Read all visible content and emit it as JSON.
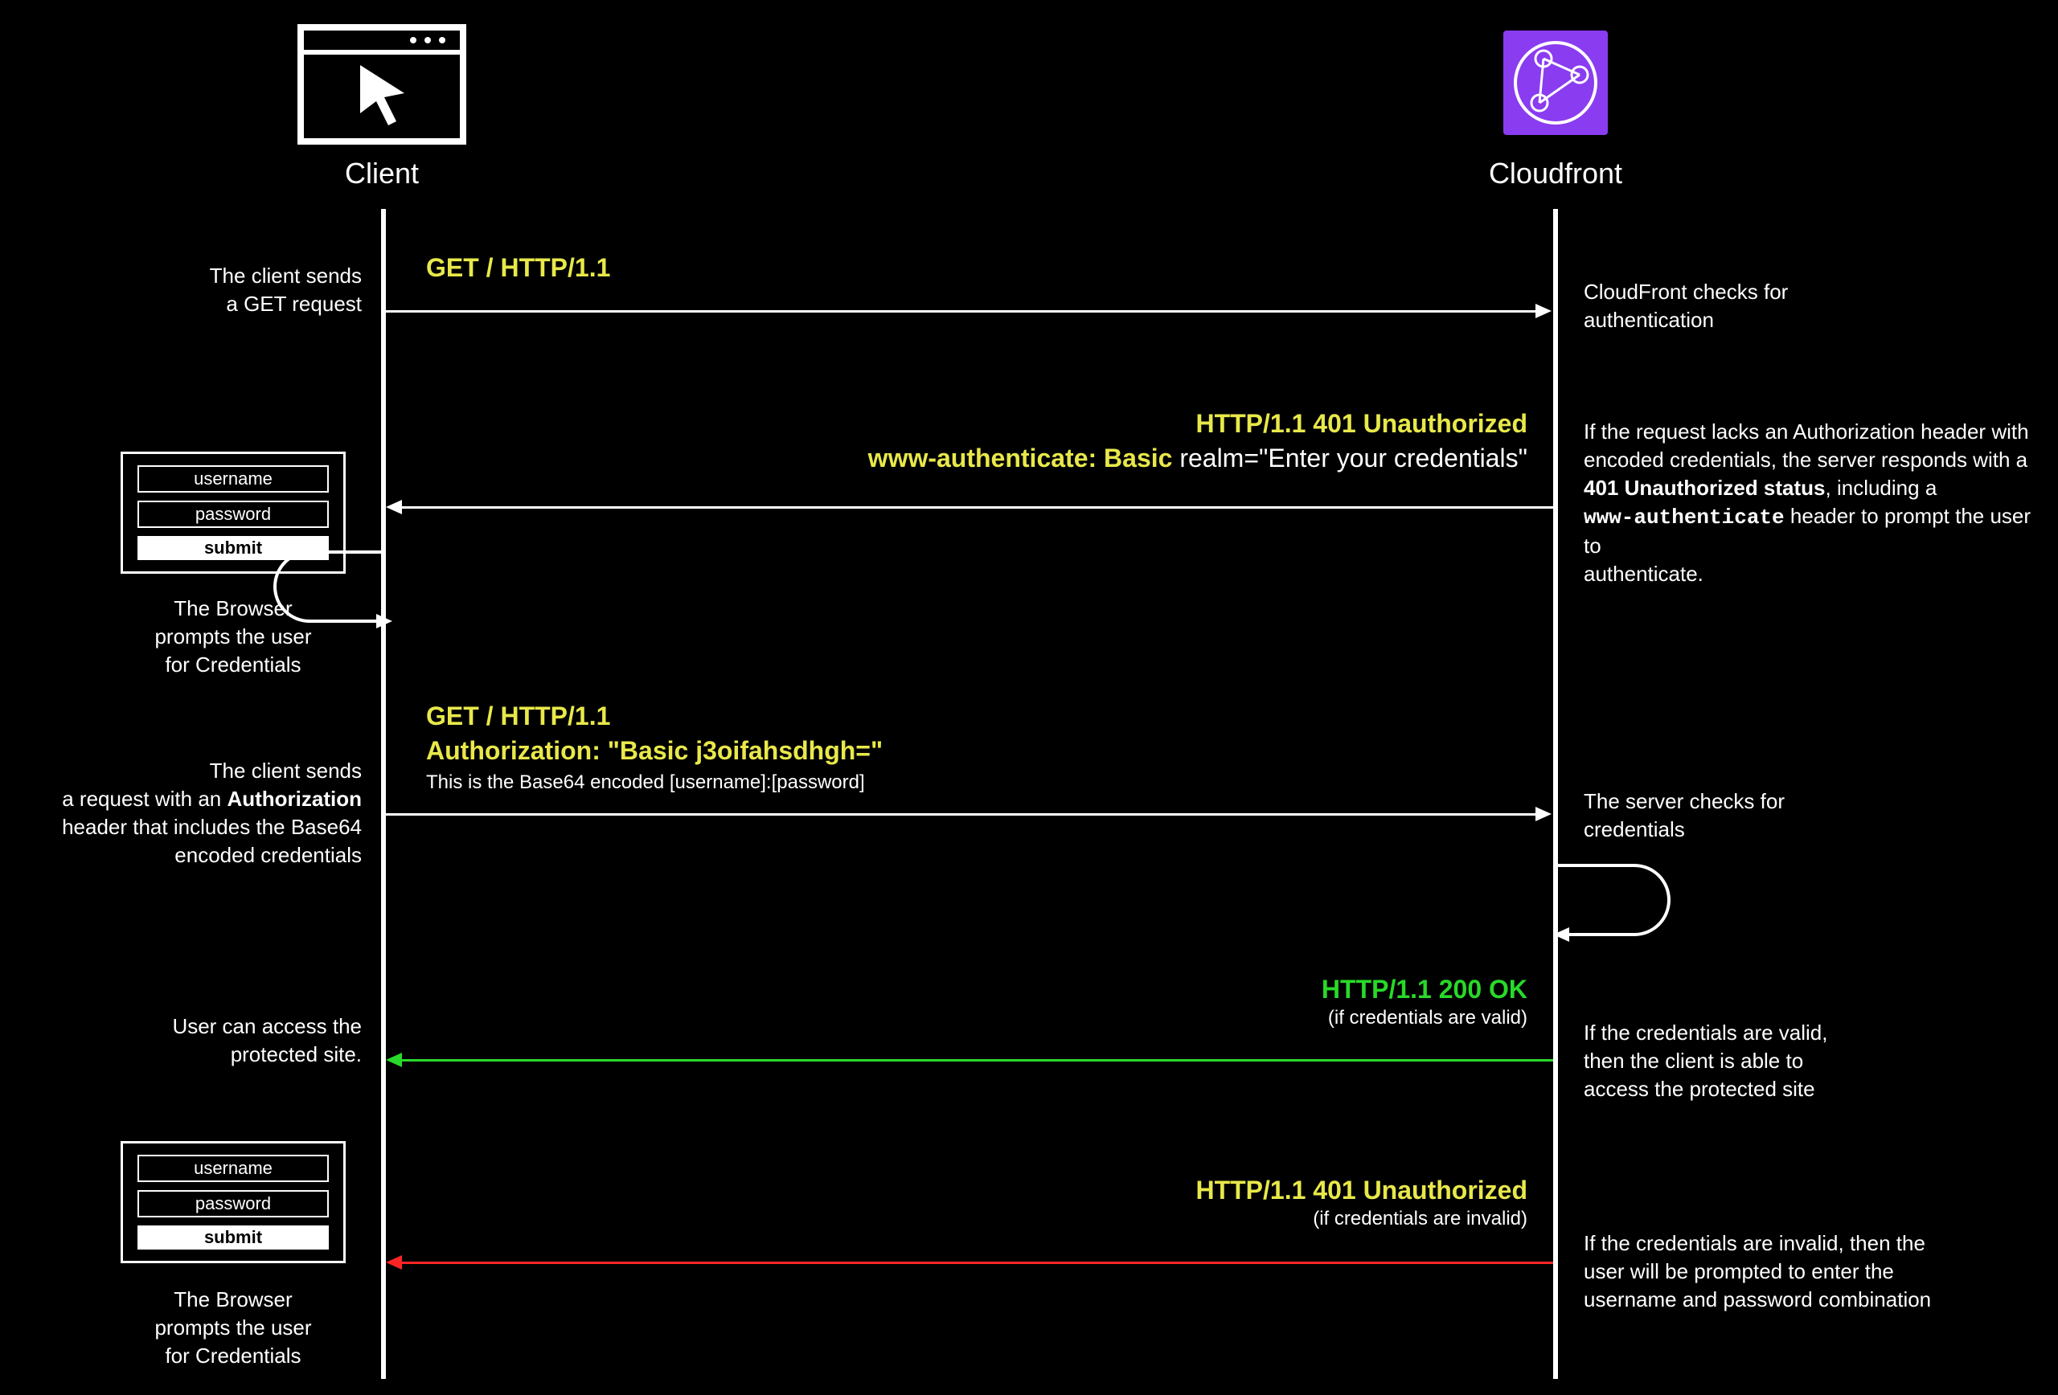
{
  "actors": {
    "client": "Client",
    "server": "Cloudfront"
  },
  "cred_box": {
    "username": "username",
    "password": "password",
    "submit": "submit"
  },
  "left_notes": {
    "n1": "The client sends\na GET request",
    "n2": "The Browser\nprompts the user\nfor Credentials",
    "n3a": "The client sends",
    "n3b": "a request with an ",
    "n3b_bold": "Authorization",
    "n3c": "header that includes the Base64\nencoded credentials",
    "n4": "User can access the\nprotected site.",
    "n5": "The Browser\nprompts the user\nfor Credentials"
  },
  "right_notes": {
    "r1": "CloudFront checks for\nauthentication",
    "r2a": "If the request lacks an Authorization header with\nencoded credentials, the server responds with a",
    "r2b_bold": "401 Unauthorized status",
    "r2b_rest": ", including a",
    "r2c_mono": "www-authenticate",
    "r2c_rest": " header to prompt the user to\nauthenticate.",
    "r3": "The server checks for\ncredentials",
    "r4": "If the credentials are valid,\nthen the client is able to\naccess the protected site",
    "r5": "If the credentials are invalid, then the\nuser will be prompted to enter the\nusername and password combination"
  },
  "messages": {
    "m1": "GET / HTTP/1.1",
    "m2a": "HTTP/1.1 401 Unauthorized",
    "m2b_y": "www-authenticate: Basic ",
    "m2b_w": "realm=\"Enter your credentials\"",
    "m3a": "GET / HTTP/1.1",
    "m3b": "Authorization: \"Basic j3oifahsdhgh=\"",
    "m3c": "This is the Base64 encoded [username]:[password]",
    "m4a": "HTTP/1.1 200 OK",
    "m4b": "(if credentials are valid)",
    "m5a": "HTTP/1.1 401 Unauthorized",
    "m5b": "(if credentials are invalid)"
  }
}
